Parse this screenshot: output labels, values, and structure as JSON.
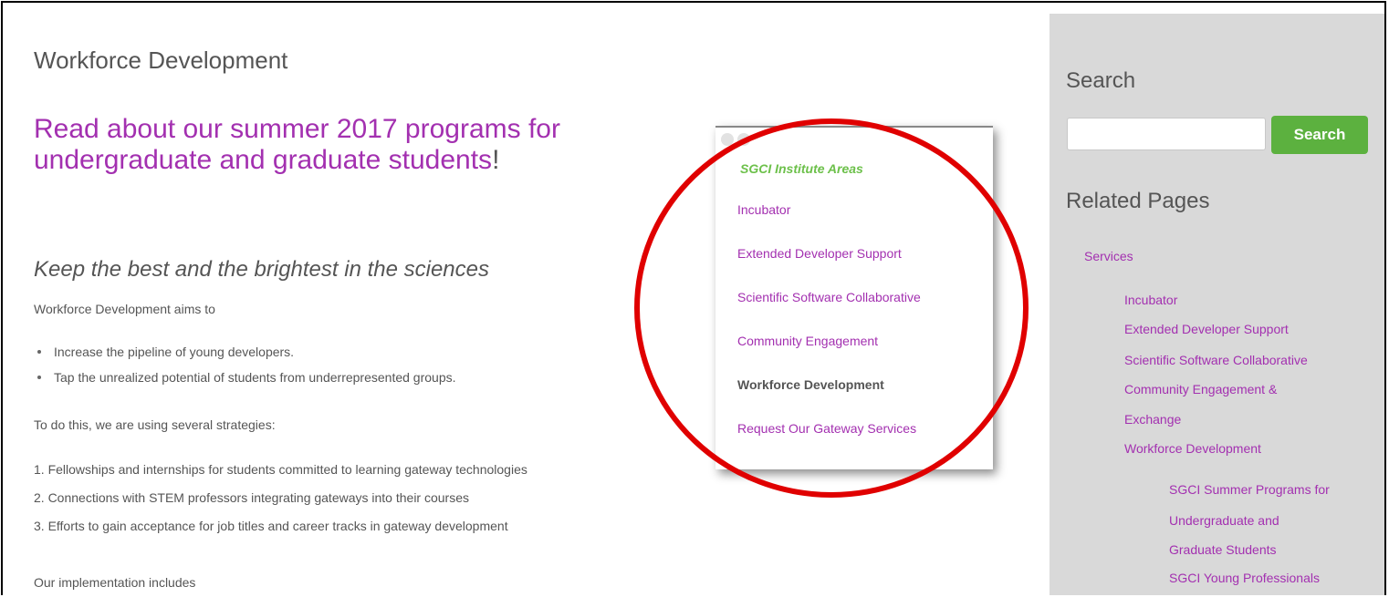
{
  "main": {
    "title": "Workforce Development",
    "promo_link": "Read about our summer 2017 programs for undergraduate and graduate students",
    "promo_punct": "!",
    "subheading": "Keep the best and the brightest in the sciences",
    "intro": "Workforce Development aims to",
    "bullets": [
      "Increase the pipeline of young developers.",
      "Tap the unrealized potential of students from underrepresented groups."
    ],
    "strategies_intro": "To do this, we are using several strategies:",
    "strategies": [
      "1.  Fellowships and internships for students committed to learning gateway technologies",
      "2.  Connections with STEM professors integrating gateways into their courses",
      "3.  Efforts to gain acceptance for job titles and career tracks in gateway development"
    ],
    "implementation_intro": "Our implementation includes"
  },
  "popup": {
    "title": "SGCI Institute Areas",
    "items": [
      "Incubator",
      "Extended Developer Support",
      "Scientific Software Collaborative",
      "Community Engagement",
      "Workforce Development",
      "Request Our Gateway Services"
    ]
  },
  "sidebar": {
    "search_heading": "Search",
    "search_value": "",
    "search_button": "Search",
    "related_heading": "Related Pages",
    "links": {
      "services": "Services",
      "incubator": "Incubator",
      "extended": "Extended Developer Support",
      "scientific": "Scientific Software Collaborative",
      "community_1": "Community Engagement &",
      "community_2": "Exchange",
      "workforce": "Workforce Development",
      "summer_1": "SGCI Summer Programs for",
      "summer_2": "Undergraduate and",
      "summer_3": "Graduate Students",
      "young": "SGCI Young Professionals"
    }
  },
  "colors": {
    "link": "#a330b0",
    "accent_green": "#5cb13f",
    "annotation_red": "#e00000",
    "sidebar_bg": "#d9d9d9"
  }
}
